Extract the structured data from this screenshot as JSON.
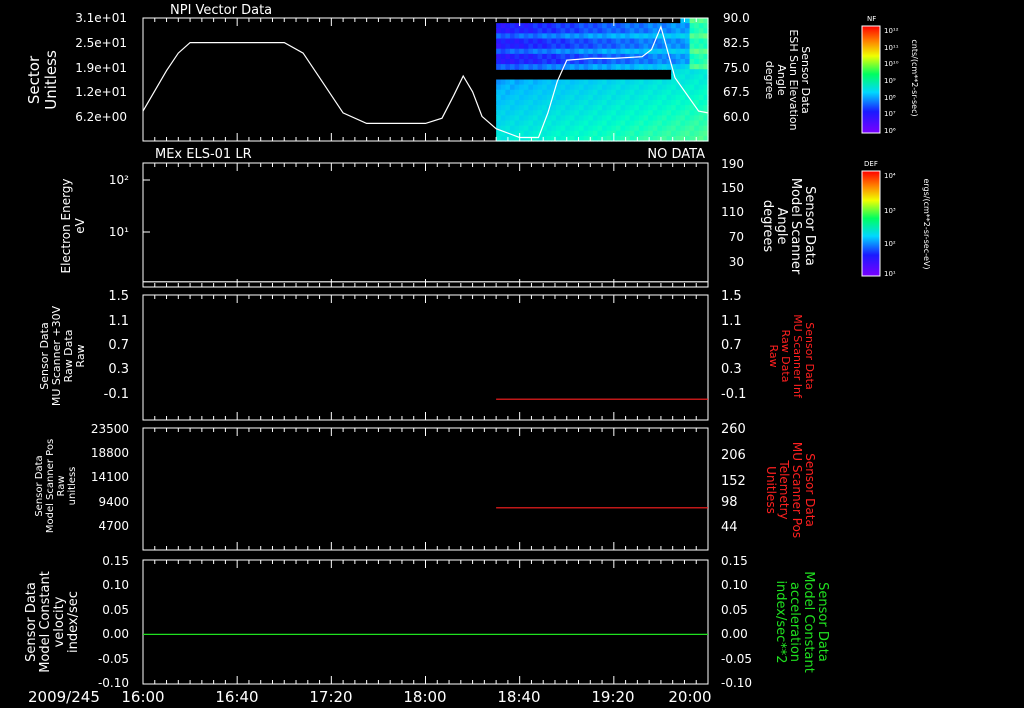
{
  "time_axis": {
    "date_label": "2009/245",
    "ticks": [
      "16:00",
      "16:40",
      "17:20",
      "18:00",
      "18:40",
      "19:20",
      "20:00"
    ],
    "start_min": 960,
    "end_min": 1200
  },
  "colors": {
    "white": "#ffffff",
    "red": "#ff2020",
    "green": "#20e020",
    "background": "#000000"
  },
  "chart_data": [
    {
      "type": "heatmap",
      "panel_label": "NPI Vector Data",
      "ylabel_left": [
        "Sector",
        "Unitless"
      ],
      "ylabel_right": [
        "Sensor Data",
        "ESH Sun Elevation",
        "Angle",
        "degree"
      ],
      "yticks_left": [
        "3.1e+01",
        "2.5e+01",
        "1.9e+01",
        "1.2e+01",
        "6.2e+00"
      ],
      "yticks_right": [
        "90.0",
        "82.5",
        "75.0",
        "67.5",
        "60.0"
      ],
      "ylim_right": [
        55,
        90
      ],
      "heatmap_start_min": 1110,
      "colorbar": {
        "label": "NF",
        "units": "cnts/(cm**2-sr-sec)",
        "ticks": [
          "10¹²",
          "10¹¹",
          "10¹⁰",
          "10⁹",
          "10⁸",
          "10⁷",
          "10⁶"
        ]
      },
      "series": [
        {
          "name": "Sensor Data ESH Sun Elevation Angle",
          "color": "#ffffff",
          "x": [
            960,
            970,
            975,
            980,
            990,
            1000,
            1020,
            1028,
            1035,
            1045,
            1055,
            1070,
            1080,
            1087,
            1092,
            1096,
            1100,
            1104,
            1110,
            1120,
            1128,
            1132,
            1136,
            1140,
            1150,
            1160,
            1172,
            1176,
            1180,
            1186,
            1196,
            1200
          ],
          "y": [
            63.5,
            75,
            80,
            83,
            83,
            83,
            83,
            80,
            73,
            63,
            60,
            60,
            60,
            61.5,
            68,
            73.5,
            69,
            62,
            58.5,
            56,
            56,
            63,
            72,
            78,
            78.5,
            78.5,
            79,
            81,
            87.5,
            73,
            63.5,
            63
          ]
        }
      ]
    },
    {
      "type": "line",
      "panel_label": "MEx ELS-01 LR",
      "status": "NO DATA",
      "ylabel_left": [
        "Electron Energy",
        "eV"
      ],
      "ylabel_right": [
        "Sensor Data",
        "Model Scanner",
        "Angle",
        "degrees"
      ],
      "yticks_left": [
        "10²",
        "10¹"
      ],
      "yticks_right": [
        "190",
        "150",
        "110",
        "70",
        "30"
      ],
      "ylim_right": [
        0,
        190
      ],
      "colorbar": {
        "label": "DEF",
        "units": "ergs/(cm**2-sr-sec-eV)",
        "ticks": [
          "10⁴",
          "10³",
          "10²",
          "10¹"
        ]
      },
      "series": [
        {
          "name": "Sensor Data Model Scanner Angle",
          "color": "#ffffff",
          "x": [
            960,
            1200
          ],
          "y": [
            8,
            8
          ]
        }
      ]
    },
    {
      "type": "line",
      "ylabel_left": [
        "Sensor Data",
        "MU Scanner +30V",
        "Raw Data",
        "Raw"
      ],
      "ylabel_right": [
        "Sensor Data",
        "MU Scanner Inf",
        "Raw Data",
        "Raw"
      ],
      "yticks_left": [
        "1.5",
        "1.1",
        "0.7",
        "0.3",
        "-0.1"
      ],
      "yticks_right": [
        "1.5",
        "1.1",
        "0.7",
        "0.3",
        "-0.1"
      ],
      "ylim": [
        -0.3,
        1.5
      ],
      "series": [
        {
          "name": "Sensor Data MU Scanner Inf Raw Data",
          "color": "#ff2020",
          "x": [
            1110,
            1200
          ],
          "y": [
            0,
            0
          ]
        }
      ]
    },
    {
      "type": "line",
      "ylabel_left": [
        "Sensor Data",
        "Model Scanner Pos",
        "Raw",
        "unitless"
      ],
      "ylabel_right": [
        "Sensor Data",
        "MU Scanner Pos",
        "Telemetry",
        "Unitless"
      ],
      "yticks_left": [
        "23500",
        "18800",
        "14100",
        "9400",
        "4700"
      ],
      "yticks_right": [
        "260",
        "206",
        "152",
        "98",
        "44"
      ],
      "ylim_right": [
        0,
        260
      ],
      "series": [
        {
          "name": "Sensor Data MU Scanner Pos Telemetry",
          "color": "#ff2020",
          "x": [
            1110,
            1200
          ],
          "y": [
            90,
            90
          ]
        }
      ]
    },
    {
      "type": "line",
      "ylabel_left": [
        "Sensor Data",
        "Model Constant",
        "velocity",
        "index/sec"
      ],
      "ylabel_right": [
        "Sensor Data",
        "Model Constant",
        "acceleration",
        "index/sec**2"
      ],
      "yticks_left": [
        "0.15",
        "0.10",
        "0.05",
        "0.00",
        "-0.05",
        "-0.10"
      ],
      "yticks_right": [
        "0.15",
        "0.10",
        "0.05",
        "0.00",
        "-0.05",
        "-0.10"
      ],
      "ylim": [
        -0.1,
        0.15
      ],
      "series": [
        {
          "name": "Sensor Data Model Constant velocity",
          "color": "#20e020",
          "x": [
            960,
            1200
          ],
          "y": [
            0,
            0
          ]
        }
      ]
    }
  ]
}
